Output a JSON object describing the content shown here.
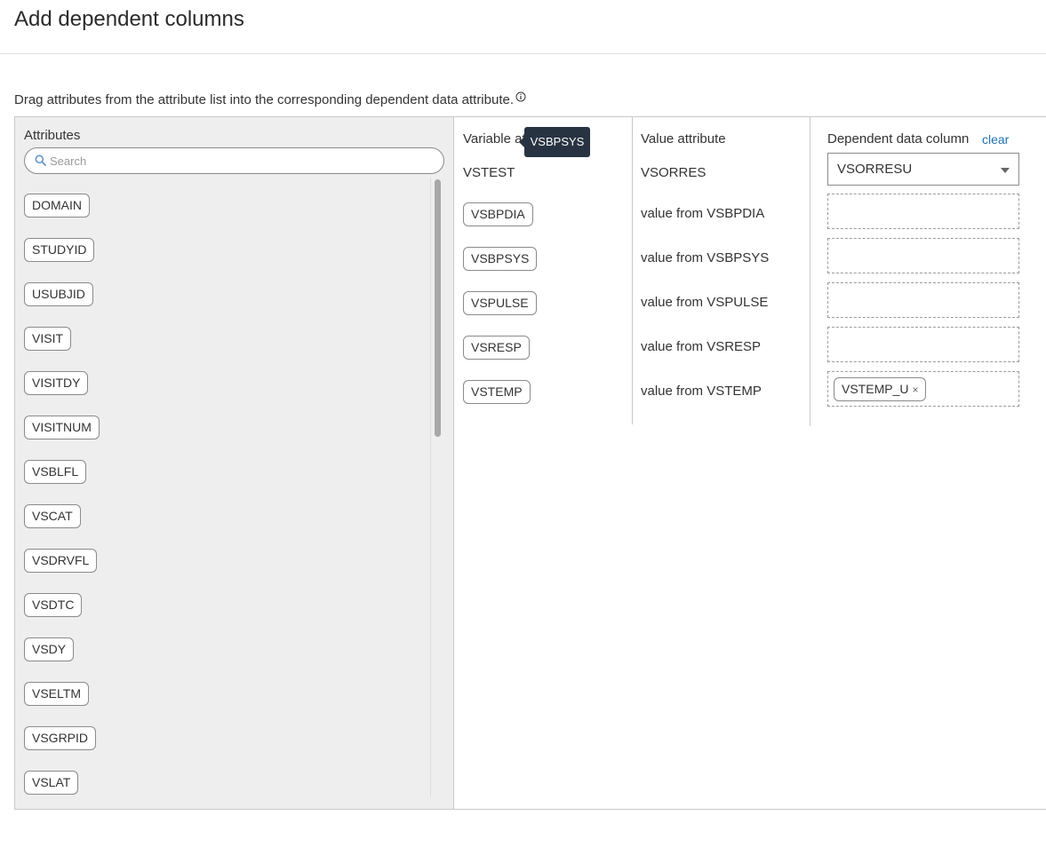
{
  "page": {
    "title": "Add dependent columns",
    "instructions": "Drag attributes from the attribute list into the corresponding dependent data attribute."
  },
  "attributes_panel": {
    "label": "Attributes",
    "search_placeholder": "Search",
    "search_value": "",
    "items": [
      "DOMAIN",
      "STUDYID",
      "USUBJID",
      "VISIT",
      "VISITDY",
      "VISITNUM",
      "VSBLFL",
      "VSCAT",
      "VSDRVFL",
      "VSDTC",
      "VSDY",
      "VSELTM",
      "VSGRPID",
      "VSLAT"
    ]
  },
  "columns": {
    "variable_header": "Variable attribute",
    "variable_attribute": "VSTEST",
    "value_header": "Value attribute",
    "value_attribute": "VSORRES",
    "dependent_header": "Dependent data column",
    "clear_label": "clear",
    "dependent_select_value": "VSORRESU"
  },
  "rows": [
    {
      "variable": "VSBPDIA",
      "value": "value from VSBPDIA",
      "dependent": ""
    },
    {
      "variable": "VSBPSYS",
      "value": "value from VSBPSYS",
      "dependent": ""
    },
    {
      "variable": "VSPULSE",
      "value": "value from VSPULSE",
      "dependent": ""
    },
    {
      "variable": "VSRESP",
      "value": "value from VSRESP",
      "dependent": ""
    },
    {
      "variable": "VSTEMP",
      "value": "value from VSTEMP",
      "dependent": "VSTEMP_U"
    }
  ],
  "tooltip": {
    "text": "VSBPSYS"
  },
  "colors": {
    "link": "#1f6fb2",
    "tooltip_bg": "#283342",
    "panel_bg": "#eeeeee"
  }
}
